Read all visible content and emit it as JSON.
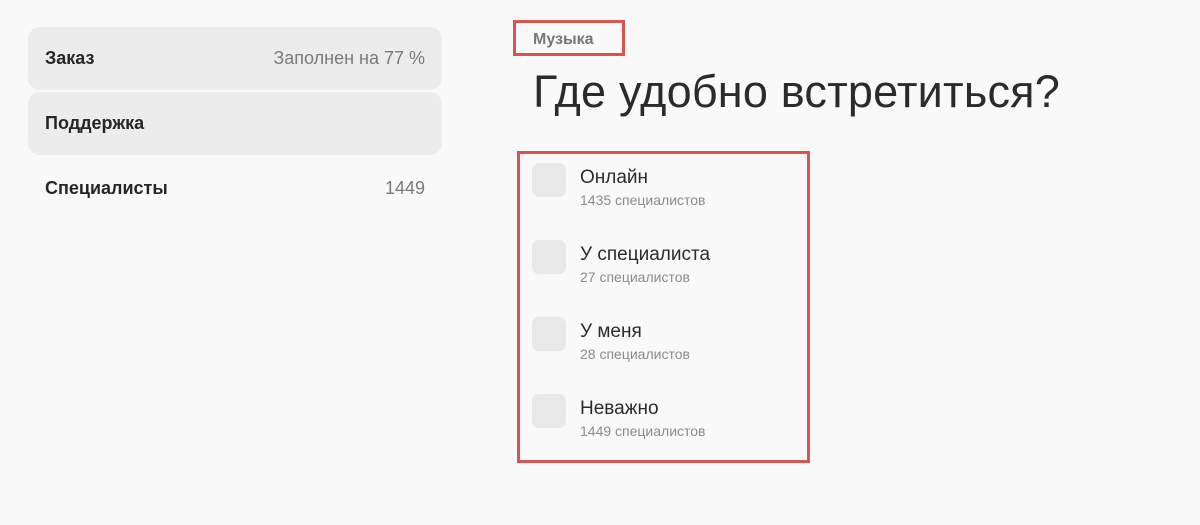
{
  "sidebar": {
    "items": [
      {
        "label": "Заказ",
        "value": "Заполнен на 77 %"
      },
      {
        "label": "Поддержка",
        "value": ""
      },
      {
        "label": "Специалисты",
        "value": "1449"
      }
    ]
  },
  "main": {
    "category": "Музыка",
    "title": "Где удобно встретиться?",
    "options": [
      {
        "label": "Онлайн",
        "count": "1435 специалистов"
      },
      {
        "label": "У специалиста",
        "count": "27 специалистов"
      },
      {
        "label": "У меня",
        "count": "28 специалистов"
      },
      {
        "label": "Неважно",
        "count": "1449 специалистов"
      }
    ]
  },
  "colors": {
    "page_background": "#f9f9f9",
    "highlight_border": "#d9534f",
    "sidebar_active_background": "#ececec",
    "checkbox_background": "#e8e8e8"
  }
}
